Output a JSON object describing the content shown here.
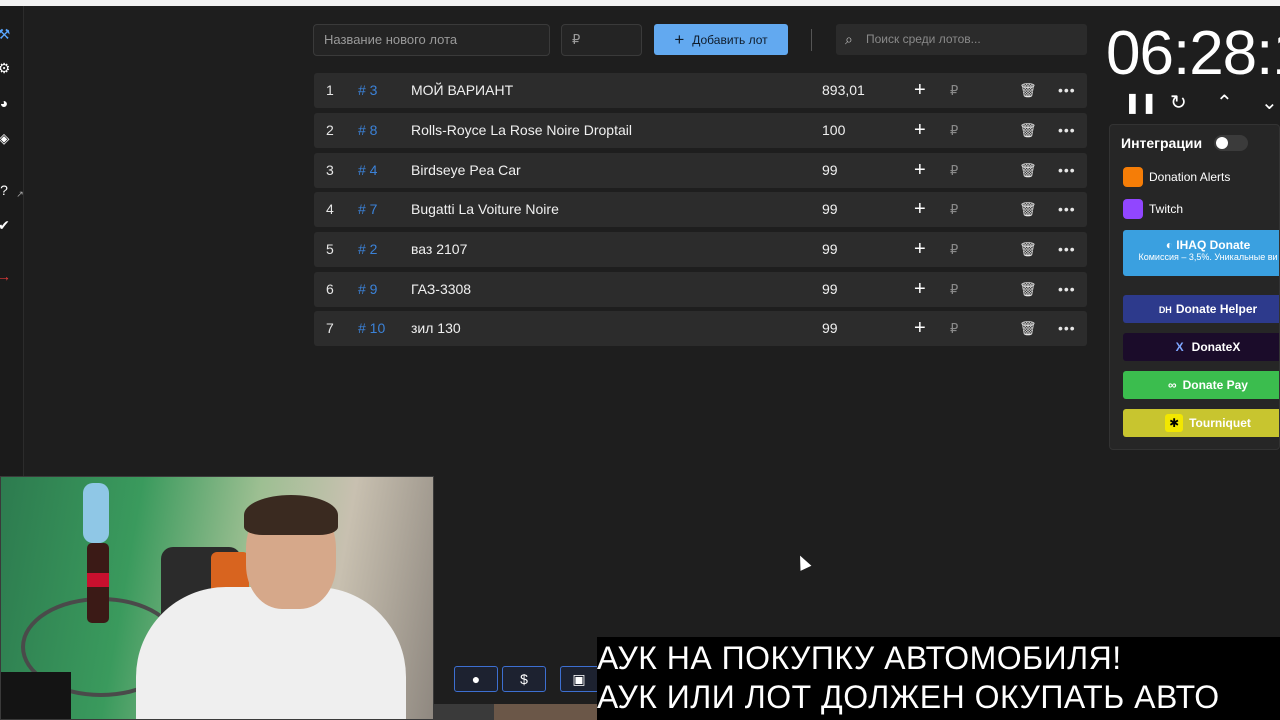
{
  "toolbar": {
    "lot_name_placeholder": "Название нового лота",
    "amount_placeholder": "₽",
    "add_button_label": "Добавить лот",
    "search_placeholder": "Поиск среди лотов..."
  },
  "lots": [
    {
      "num": "1",
      "id": "# 3",
      "name": "МОЙ ВАРИАНТ",
      "amount": "893,01"
    },
    {
      "num": "2",
      "id": "# 8",
      "name": "Rolls-Royce La Rose Noire Droptail",
      "amount": "100"
    },
    {
      "num": "3",
      "id": "# 4",
      "name": "Birdseye Pea Car",
      "amount": "99"
    },
    {
      "num": "4",
      "id": "# 7",
      "name": "Bugatti La Voiture Noire",
      "amount": "99"
    },
    {
      "num": "5",
      "id": "# 2",
      "name": "ваз 2107",
      "amount": "99"
    },
    {
      "num": "6",
      "id": "# 9",
      "name": "ГАЗ-3308",
      "amount": "99"
    },
    {
      "num": "7",
      "id": "# 10",
      "name": "зил 130",
      "amount": "99"
    }
  ],
  "currency_symbol": "₽",
  "timer": {
    "display": "06:28:1"
  },
  "integrations": {
    "title": "Интеграции",
    "items": [
      {
        "label": "Donation Alerts",
        "icon": "donation-alerts-icon",
        "color": "#f57d07"
      },
      {
        "label": "Twitch",
        "icon": "twitch-icon",
        "color": "#9146ff"
      }
    ],
    "payments": [
      {
        "label": "IHAQ Donate",
        "sub": "Комиссия – 3,5%. Уникальные ви",
        "color": "#3aa0e0"
      },
      {
        "label": "Donate Helper",
        "badge": "DH",
        "color": "#2d3a8c"
      },
      {
        "label": "DonateX",
        "badge": "X",
        "color": "#1b0c2a"
      },
      {
        "label": "Donate Pay",
        "badge": "∞",
        "color": "#3bbd4e"
      },
      {
        "label": "Tourniquet",
        "badge": "✱",
        "color": "#c8c52f"
      }
    ]
  },
  "bottom_buttons": {
    "github": "github-icon",
    "dollar": "$",
    "save": "save-icon"
  },
  "banner": {
    "line1": "АУК НА ПОКУПКУ АВТОМОБИЛЯ!",
    "line2": "АУК ИЛИ ЛОТ ДОЛЖЕН ОКУПАТЬ АВТО"
  }
}
